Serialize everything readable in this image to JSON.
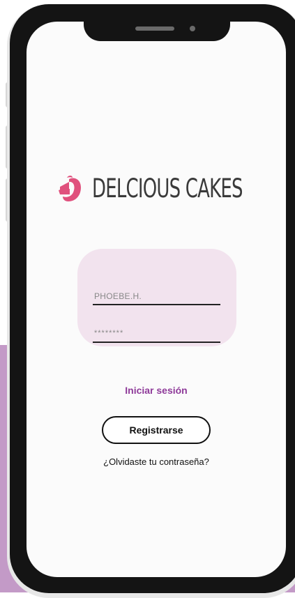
{
  "brand": {
    "name": "DELCIOUS CAKES",
    "logo_icon": "cake-slice-icon",
    "accent_color": "#e0517d"
  },
  "login_form": {
    "username_value": "PHOEBE.H.",
    "password_value": "********"
  },
  "actions": {
    "login_label": "Iniciar sesión",
    "register_label": "Registrarse",
    "forgot_password_label": "¿Olvidaste tu contraseña?"
  },
  "colors": {
    "background_accent": "#c39ac7",
    "card_background": "#f2e3ee",
    "link_color": "#8e3a99"
  }
}
